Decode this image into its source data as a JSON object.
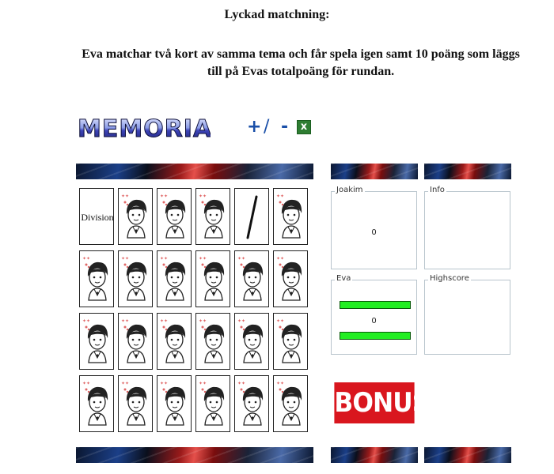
{
  "caption": {
    "title": "Lyckad matchning:",
    "body": "Eva matchar två kort av samma tema och får spela igen samt 10 poäng som läggs till på Evas totalpoäng för rundan."
  },
  "app": {
    "logo_text": "MEMORIA",
    "toolbar": {
      "add": "+",
      "separator": "/",
      "remove": "-",
      "export_icon": "excel-icon",
      "export_glyph": "x"
    }
  },
  "board": {
    "rows": 4,
    "cols": 6,
    "cards": [
      {
        "kind": "text",
        "text": "Division"
      },
      {
        "kind": "back"
      },
      {
        "kind": "back"
      },
      {
        "kind": "back"
      },
      {
        "kind": "symbol",
        "icon": "slash-icon"
      },
      {
        "kind": "back"
      },
      {
        "kind": "back"
      },
      {
        "kind": "back"
      },
      {
        "kind": "back"
      },
      {
        "kind": "back"
      },
      {
        "kind": "back"
      },
      {
        "kind": "back"
      },
      {
        "kind": "back"
      },
      {
        "kind": "back"
      },
      {
        "kind": "back"
      },
      {
        "kind": "back"
      },
      {
        "kind": "back"
      },
      {
        "kind": "back"
      },
      {
        "kind": "back"
      },
      {
        "kind": "back"
      },
      {
        "kind": "back"
      },
      {
        "kind": "back"
      },
      {
        "kind": "back"
      },
      {
        "kind": "back"
      }
    ]
  },
  "players": [
    {
      "name": "Joakim",
      "score": "0",
      "active": false
    },
    {
      "name": "Eva",
      "score": "0",
      "active": true
    }
  ],
  "panels": {
    "info": "Info",
    "highscore": "Highscore"
  },
  "bonus": "BONUS",
  "colors": {
    "active_bar": "#22ee22",
    "bonus": "#d9161e",
    "logo_top": "#b9c7ff",
    "logo_bottom": "#2b2f8c"
  }
}
